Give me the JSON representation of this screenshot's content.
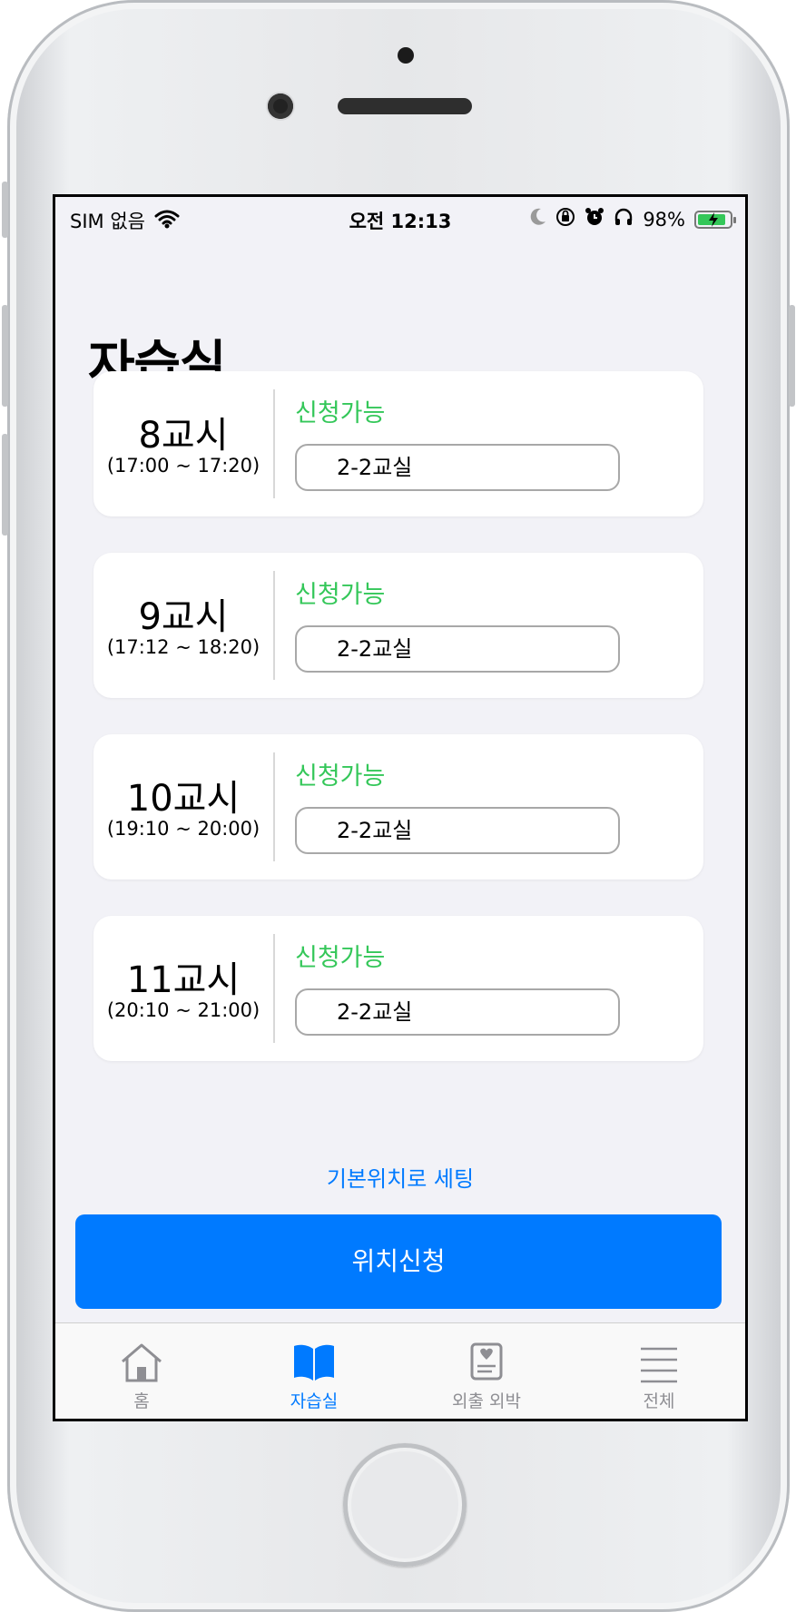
{
  "status_bar": {
    "carrier": "SIM 없음",
    "time": "오전 12:13",
    "battery": "98%",
    "icons": [
      "wifi-icon",
      "moon-icon",
      "orientation-lock-icon",
      "alarm-icon",
      "headphones-icon",
      "battery-charging-icon"
    ]
  },
  "page": {
    "title": "자습실"
  },
  "slots": [
    {
      "period": "8교시",
      "time": "(17:00 ~ 17:20)",
      "status": "신청가능",
      "room": "2-2교실"
    },
    {
      "period": "9교시",
      "time": "(17:12 ~ 18:20)",
      "status": "신청가능",
      "room": "2-2교실"
    },
    {
      "period": "10교시",
      "time": "(19:10 ~ 20:00)",
      "status": "신청가능",
      "room": "2-2교실"
    },
    {
      "period": "11교시",
      "time": "(20:10 ~ 21:00)",
      "status": "신청가능",
      "room": "2-2교실"
    }
  ],
  "actions": {
    "reset_label": "기본위치로 세팅",
    "apply_label": "위치신청"
  },
  "tabbar": {
    "items": [
      {
        "label": "홈",
        "icon": "home-icon"
      },
      {
        "label": "자습실",
        "icon": "book-icon",
        "active": true
      },
      {
        "label": "외출 외박",
        "icon": "id-card-icon"
      },
      {
        "label": "전체",
        "icon": "menu-icon"
      }
    ]
  },
  "colors": {
    "accent": "#007aff",
    "available": "#34c759",
    "background": "#f2f2f7"
  }
}
